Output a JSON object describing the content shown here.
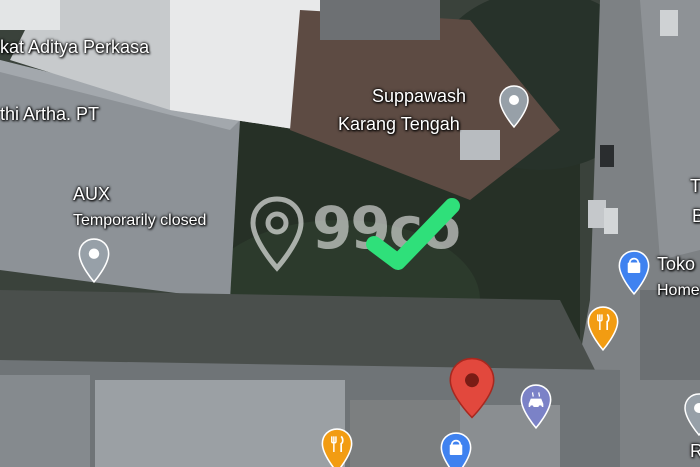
{
  "map": {
    "labels": {
      "aditya": "kat Aditya Perkasa",
      "artha": "thi Artha. PT",
      "suppawash_1": "Suppawash",
      "suppawash_2": "Karang Tengah",
      "aux": "AUX",
      "aux_status": "Temporarily closed",
      "toko": "Toko",
      "toko_sub": "Home",
      "edge_b": "B",
      "edge_t": "T",
      "edge_r": "R"
    },
    "watermark": {
      "text": "99co",
      "logo": "99co-location-logo-icon"
    },
    "markers": {
      "check": "green-checkmark-icon",
      "pin_red": "red-location-pin-icon",
      "restaurant": "fork-knife-icon",
      "shopping": "shopping-bag-icon",
      "car_wash": "car-wash-icon",
      "generic": "location-pin-icon"
    },
    "colors": {
      "red_pin": "#e2483d",
      "orange_pin": "#f29c12",
      "blue_pin": "#3f82f0",
      "purple_pin": "#7b82c7",
      "gray_pin": "#97a0a8",
      "check": "#2fe07a"
    }
  }
}
